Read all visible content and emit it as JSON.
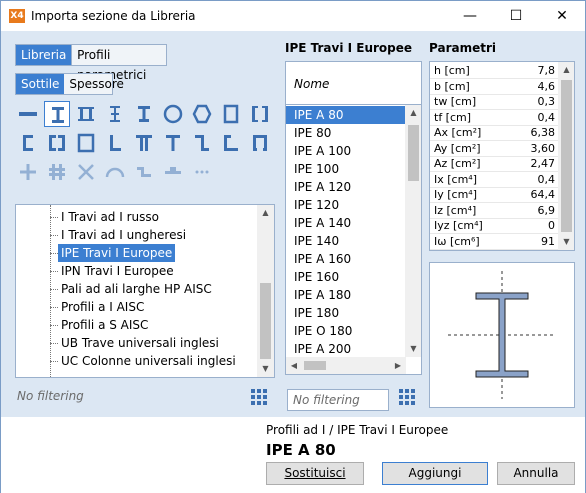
{
  "window": {
    "title": "Importa sezione da Libreria",
    "app_icon": "X4"
  },
  "source_toggle": {
    "options": [
      "Libreria",
      "Profili parametrici"
    ],
    "active": "Libreria"
  },
  "thickness_toggle": {
    "options": [
      "Sottile",
      "Spessore"
    ],
    "active": "Sottile"
  },
  "shapes": [
    "flat-bar",
    "i-beam",
    "double-i",
    "welded-i",
    "t-section",
    "circle",
    "hexagon",
    "rect-tube",
    "double-channel",
    "channel",
    "double-channel-open",
    "box",
    "angle",
    "double-t",
    "tee",
    "z-section",
    "z-section-alt",
    "lip-channel",
    "cross",
    "cross-double",
    "x-cross",
    "arc",
    "cold-formed",
    "hat",
    "more"
  ],
  "selected_shape": "i-beam",
  "tree": {
    "items": [
      "I Travi ad I russo",
      "I Travi ad I ungheresi",
      "IPE Travi I Europee",
      "IPN Travi I Europee",
      "Pali ad ali larghe HP AISC",
      "Profili a I AISC",
      "Profili a S AISC",
      "UB Trave universali inglesi",
      "UC Colonne universali inglesi"
    ],
    "selected": "IPE Travi I Europee",
    "filter_placeholder": "No filtering"
  },
  "profiles": {
    "title": "IPE Travi I Europee",
    "header": "Nome",
    "items": [
      "IPE A 80",
      "IPE  80",
      "IPE A 100",
      "IPE 100",
      "IPE A 120",
      "IPE 120",
      "IPE A 140",
      "IPE 140",
      "IPE A 160",
      "IPE 160",
      "IPE A 180",
      "IPE 180",
      "IPE O 180",
      "IPE A 200"
    ],
    "selected": "IPE A 80",
    "filter_placeholder": "No filtering"
  },
  "parameters": {
    "title": "Parametri",
    "rows": [
      {
        "name": "h [cm]",
        "value": "7,8"
      },
      {
        "name": "b [cm]",
        "value": "4,6"
      },
      {
        "name": "tw [cm]",
        "value": "0,3"
      },
      {
        "name": "tf [cm]",
        "value": "0,4"
      },
      {
        "name": "Ax [cm²]",
        "value": "6,38"
      },
      {
        "name": "Ay [cm²]",
        "value": "3,60"
      },
      {
        "name": "Az [cm²]",
        "value": "2,47"
      },
      {
        "name": "Ix [cm⁴]",
        "value": "0,4"
      },
      {
        "name": "Iy [cm⁴]",
        "value": "64,4"
      },
      {
        "name": "Iz [cm⁴]",
        "value": "6,9"
      },
      {
        "name": "Iyz [cm⁴]",
        "value": "0"
      },
      {
        "name": "Iω [cm⁶]",
        "value": "91"
      }
    ]
  },
  "footer": {
    "breadcrumb": "Profili ad I / IPE Travi I Europee",
    "selected_name": "IPE A 80",
    "replace_label": "Sostituisci",
    "add_label": "Aggiungi",
    "cancel_label": "Annulla"
  },
  "colors": {
    "accent": "#3c7fd1",
    "background": "#dce7f3",
    "icon": "#3c6fb0"
  }
}
